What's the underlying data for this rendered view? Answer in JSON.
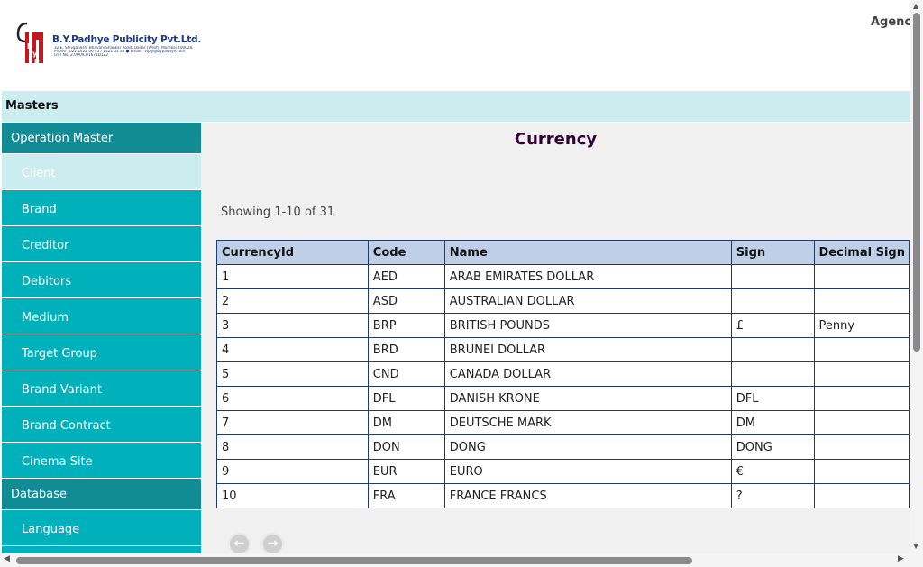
{
  "header": {
    "company_name": "B.Y.Padhye Publicity Pvt.Ltd.",
    "address_line1": "32 E, Shivganesh, Bhavani Shankar Road, Dadar (West), Mumbai 400028.",
    "address_line2": "Phone : 022 2422 06 45 / 2422 52 41  ●  Email : vijay@bypadhye.com",
    "address_line3": "GST No. 27AAACB1671D1Z2",
    "agency_label": "Agency"
  },
  "masters_bar": {
    "label": "Masters"
  },
  "sidebar": {
    "sections": [
      {
        "title": "Operation Master",
        "items": [
          {
            "label": "Client",
            "active": true
          },
          {
            "label": "Brand"
          },
          {
            "label": "Creditor"
          },
          {
            "label": "Debitors"
          },
          {
            "label": "Medium"
          },
          {
            "label": "Target Group"
          },
          {
            "label": "Brand Variant"
          },
          {
            "label": "Brand Contract"
          },
          {
            "label": "Cinema Site"
          }
        ]
      },
      {
        "title": "Database",
        "items": [
          {
            "label": "Language"
          }
        ]
      }
    ]
  },
  "main": {
    "title": "Currency",
    "showing": "Showing 1-10 of 31",
    "table": {
      "columns": [
        "CurrencyId",
        "Code",
        "Name",
        "Sign",
        "Decimal Sign"
      ],
      "rows": [
        [
          "1",
          "AED",
          "ARAB EMIRATES DOLLAR",
          "",
          ""
        ],
        [
          "2",
          "ASD",
          "AUSTRALIAN DOLLAR",
          "",
          ""
        ],
        [
          "3",
          "BRP",
          "BRITISH POUNDS",
          "£",
          "Penny"
        ],
        [
          "4",
          "BRD",
          "BRUNEI DOLLAR",
          "",
          ""
        ],
        [
          "5",
          "CND",
          "CANADA DOLLAR",
          "",
          ""
        ],
        [
          "6",
          "DFL",
          "DANISH KRONE",
          "DFL",
          ""
        ],
        [
          "7",
          "DM",
          "DEUTSCHE MARK",
          "DM",
          ""
        ],
        [
          "8",
          "DON",
          "DONG",
          "DONG",
          ""
        ],
        [
          "9",
          "EUR",
          "EURO",
          "€",
          ""
        ],
        [
          "10",
          "FRA",
          "FRANCE FRANCS",
          "?",
          ""
        ]
      ]
    },
    "pager": {
      "prev_icon": "arrow-left-icon",
      "next_icon": "arrow-right-icon"
    }
  },
  "colors": {
    "section_header": "#118b94",
    "menu_item": "#00b1bc",
    "active_item": "#cbedf0",
    "masters_bar": "#cbedf0",
    "table_header": "#c0cfe8",
    "title": "#330033"
  }
}
